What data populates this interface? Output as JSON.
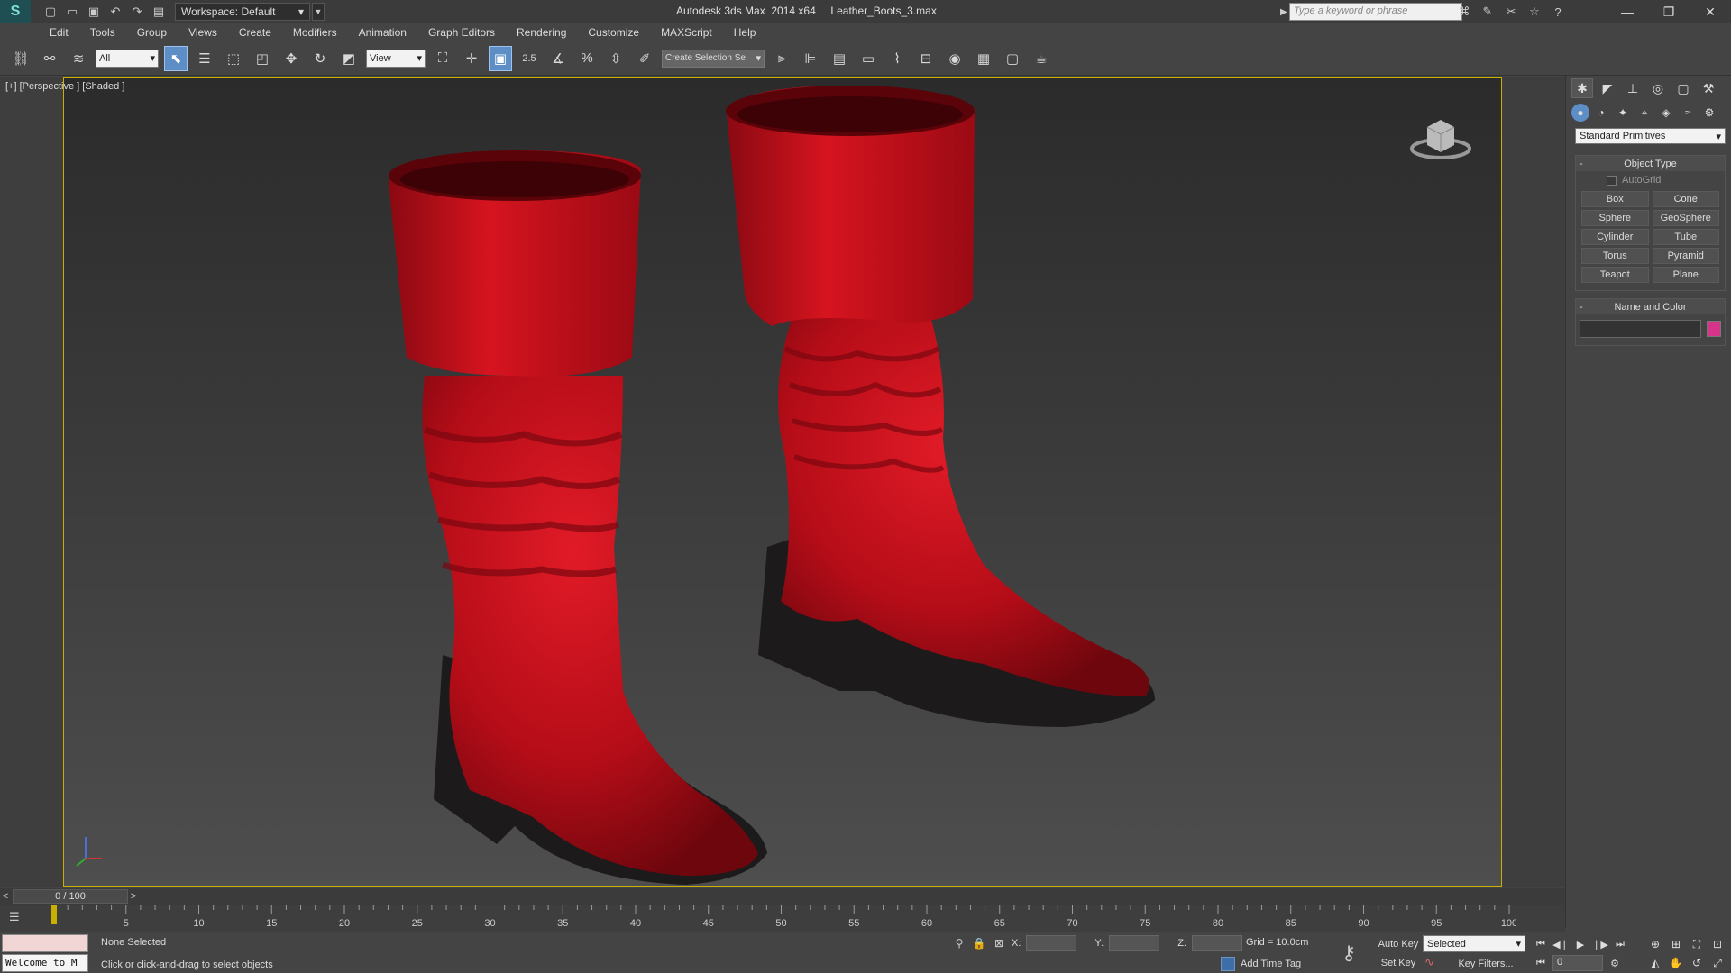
{
  "titlebar": {
    "workspace_label": "Workspace: Default",
    "title": "Autodesk 3ds Max  2014 x64     Leather_Boots_3.max",
    "search_placeholder": "Type a keyword or phrase"
  },
  "menubar": {
    "items": [
      "Edit",
      "Tools",
      "Group",
      "Views",
      "Create",
      "Modifiers",
      "Animation",
      "Graph Editors",
      "Rendering",
      "Customize",
      "MAXScript",
      "Help"
    ]
  },
  "toolbar": {
    "selection_filter": "All",
    "ref_coord": "View",
    "snap_value": "2.5",
    "named_selection": "Create Selection Se"
  },
  "viewport": {
    "label": "[+] [Perspective ] [Shaded ]",
    "boot_color": "#c3101b",
    "sole_color": "#1c1a1a"
  },
  "command_panel": {
    "dropdown": "Standard Primitives",
    "object_type": {
      "title": "Object Type",
      "autogrid": "AutoGrid",
      "buttons": [
        "Box",
        "Cone",
        "Sphere",
        "GeoSphere",
        "Cylinder",
        "Tube",
        "Torus",
        "Pyramid",
        "Teapot",
        "Plane"
      ]
    },
    "name_color": {
      "title": "Name and Color",
      "swatch": "#d6338a"
    }
  },
  "timeslider": {
    "frame": "0 / 100",
    "prev": "<",
    "next": ">"
  },
  "trackbar": {
    "ticks": [
      "5",
      "10",
      "15",
      "20",
      "25",
      "30",
      "35",
      "40",
      "45",
      "50",
      "55",
      "60",
      "65",
      "70",
      "75",
      "80",
      "85",
      "90",
      "95",
      "100"
    ]
  },
  "status": {
    "listener": "Welcome to M",
    "selection": "None Selected",
    "prompt": "Click or click-and-drag to select objects",
    "x_label": "X:",
    "y_label": "Y:",
    "z_label": "Z:",
    "grid": "Grid = 10.0cm",
    "add_time_tag": "Add Time Tag",
    "auto_key": "Auto Key",
    "set_key": "Set Key",
    "key_mode": "Selected",
    "key_filters": "Key Filters...",
    "current_frame": "0"
  }
}
